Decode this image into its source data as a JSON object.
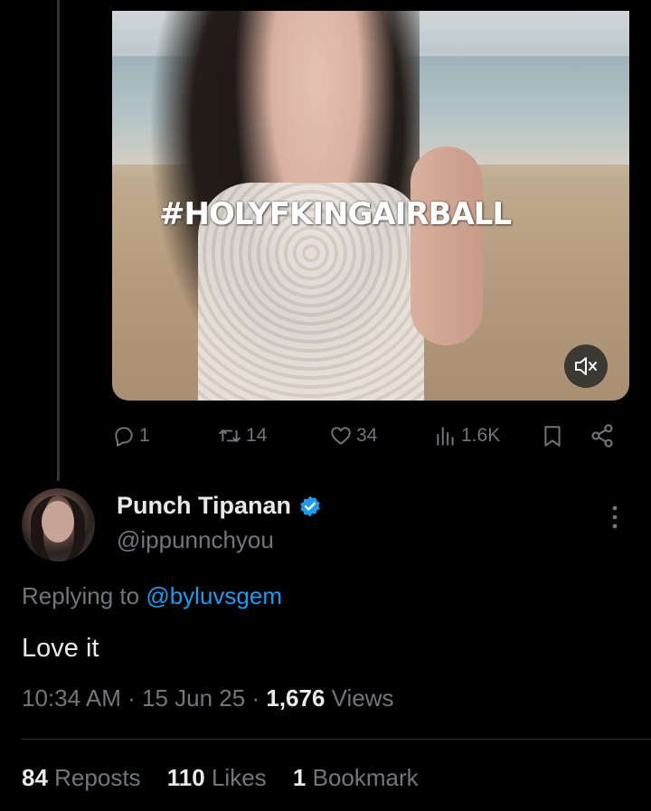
{
  "media": {
    "overlay_text": "#HOLYFKINGAIRBALL",
    "mute_icon": "speaker-muted-icon"
  },
  "parent_actions": {
    "replies": "1",
    "reposts": "14",
    "likes": "34",
    "views": "1.6K",
    "icons": [
      "reply-icon",
      "repost-icon",
      "heart-icon",
      "views-icon",
      "bookmark-icon",
      "share-icon"
    ]
  },
  "reply": {
    "display_name": "Punch Tipanan",
    "handle": "@ippunnchyou",
    "verified": true,
    "replying_prefix": "Replying to",
    "replying_to": "@byluvsgem",
    "text": "Love it",
    "time": "10:34 AM",
    "date": "15 Jun 25",
    "views_count": "1,676",
    "views_label": "Views",
    "sep": "·"
  },
  "stats": {
    "reposts_count": "84",
    "reposts_label": "Reposts",
    "likes_count": "110",
    "likes_label": "Likes",
    "bookmarks_count": "1",
    "bookmarks_label": "Bookmark"
  },
  "colors": {
    "background": "#000000",
    "primary_text": "#e7e9ea",
    "secondary_text": "#71767b",
    "link": "#1d9bf0",
    "verified_badge": "#1d9bf0"
  }
}
